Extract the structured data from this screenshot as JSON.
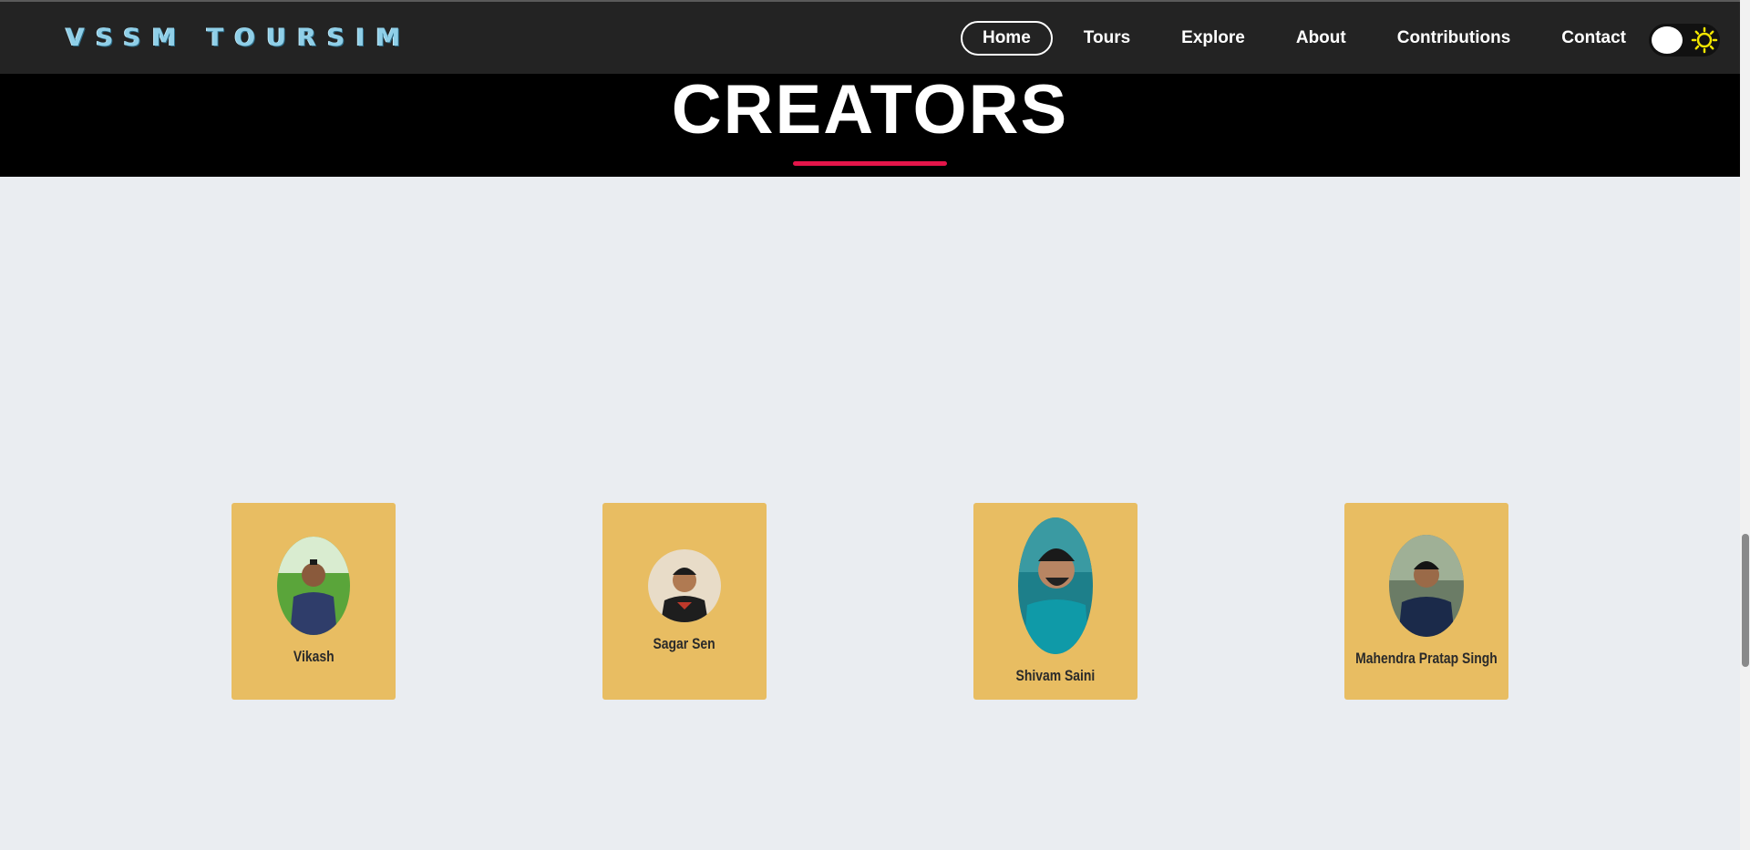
{
  "brand": {
    "name": "VSSM TOURSIM"
  },
  "nav": {
    "items": [
      {
        "label": "Home",
        "active": true
      },
      {
        "label": "Tours",
        "active": false
      },
      {
        "label": "Explore",
        "active": false
      },
      {
        "label": "About",
        "active": false
      },
      {
        "label": "Contributions",
        "active": false
      },
      {
        "label": "Contact",
        "active": false
      }
    ],
    "theme_toggle_icon": "sun-icon"
  },
  "section": {
    "title": "CREATORS",
    "accent_color": "#e4154a"
  },
  "creators": [
    {
      "name": "Vikash",
      "photo": "avatar-photo"
    },
    {
      "name": "Sagar Sen",
      "photo": "avatar-photo"
    },
    {
      "name": "Shivam Saini",
      "photo": "avatar-photo"
    },
    {
      "name": "Mahendra Pratap Singh",
      "photo": "avatar-photo"
    }
  ],
  "colors": {
    "navbar": "#232323",
    "card": "#e8bd62",
    "page_bg": "#eaedf1",
    "logo": "#8fcfe8"
  }
}
